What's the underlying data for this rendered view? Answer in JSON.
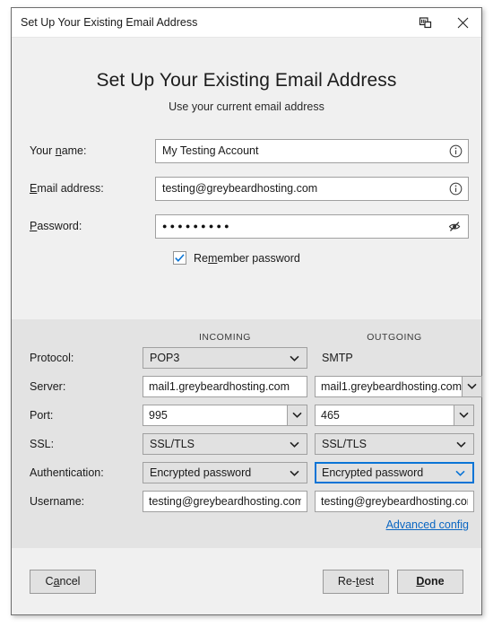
{
  "window": {
    "title": "Set Up Your Existing Email Address",
    "restore_icon": "display-restore-icon",
    "close_icon": "close-icon"
  },
  "header": {
    "heading": "Set Up Your Existing Email Address",
    "subheading": "Use your current email address"
  },
  "account_form": {
    "name": {
      "label_pre": "Your ",
      "label_mnemonic": "n",
      "label_post": "ame:",
      "value": "My Testing Account",
      "info_icon": "info-icon"
    },
    "email": {
      "label_pre": "",
      "label_mnemonic": "E",
      "label_post": "mail address:",
      "value": "testing@greybeardhosting.com",
      "info_icon": "info-icon"
    },
    "password": {
      "label_pre": "",
      "label_mnemonic": "P",
      "label_post": "assword:",
      "value": "●●●●●●●●●",
      "reveal_icon": "eye-slash-icon"
    },
    "remember": {
      "label_pre": "Re",
      "label_mnemonic": "m",
      "label_post": "ember password",
      "checked": true,
      "check_color": "#0a74d6"
    }
  },
  "manual_config": {
    "column_headers": {
      "incoming": "INCOMING",
      "outgoing": "OUTGOING"
    },
    "rows": [
      {
        "label": "Protocol:",
        "incoming": {
          "type": "select",
          "value": "POP3",
          "disabled": false
        },
        "outgoing": {
          "type": "text-static",
          "value": "SMTP"
        }
      },
      {
        "label": "Server:",
        "incoming": {
          "type": "input",
          "value": "mail1.greybeardhosting.com"
        },
        "outgoing": {
          "type": "combo",
          "value": "mail1.greybeardhosting.com"
        }
      },
      {
        "label": "Port:",
        "incoming": {
          "type": "combo",
          "value": "995"
        },
        "outgoing": {
          "type": "combo",
          "value": "465"
        }
      },
      {
        "label": "SSL:",
        "incoming": {
          "type": "select",
          "value": "SSL/TLS"
        },
        "outgoing": {
          "type": "select",
          "value": "SSL/TLS"
        }
      },
      {
        "label": "Authentication:",
        "incoming": {
          "type": "select",
          "value": "Encrypted password"
        },
        "outgoing": {
          "type": "select",
          "value": "Encrypted password",
          "focused": true
        }
      },
      {
        "label": "Username:",
        "incoming": {
          "type": "input",
          "value": "testing@greybeardhosting.com"
        },
        "outgoing": {
          "type": "input",
          "value": "testing@greybeardhosting.com"
        }
      }
    ],
    "advanced_link": "Advanced config",
    "link_color": "#0a66c2"
  },
  "buttons": {
    "cancel": {
      "pre": "C",
      "mnemonic": "a",
      "post": "ncel"
    },
    "retest": {
      "pre": "Re-",
      "mnemonic": "t",
      "post": "est"
    },
    "done": {
      "pre": "",
      "mnemonic": "D",
      "post": "one",
      "default": true
    }
  }
}
